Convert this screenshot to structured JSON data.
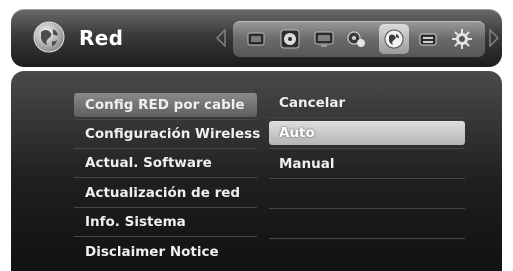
{
  "header": {
    "title": "Red",
    "section_icon": "network-globe-icon",
    "tray_icons": [
      {
        "name": "movie-icon"
      },
      {
        "name": "disc-icon"
      },
      {
        "name": "monitor-icon"
      },
      {
        "name": "audio-settings-icon"
      },
      {
        "name": "network-globe-icon",
        "selected": true
      },
      {
        "name": "lock-icon"
      },
      {
        "name": "gear-icon"
      }
    ]
  },
  "menu": {
    "items": [
      {
        "label": "Config RED por cable",
        "selected": true
      },
      {
        "label": "Configuración Wireless"
      },
      {
        "label": "Actual. Software"
      },
      {
        "label": "Actualización de red"
      },
      {
        "label": "Info. Sistema"
      },
      {
        "label": "Disclaimer Notice"
      }
    ]
  },
  "options": {
    "items": [
      {
        "label": "Cancelar"
      },
      {
        "label": "Auto",
        "highlighted": true
      },
      {
        "label": "Manual"
      }
    ]
  }
}
